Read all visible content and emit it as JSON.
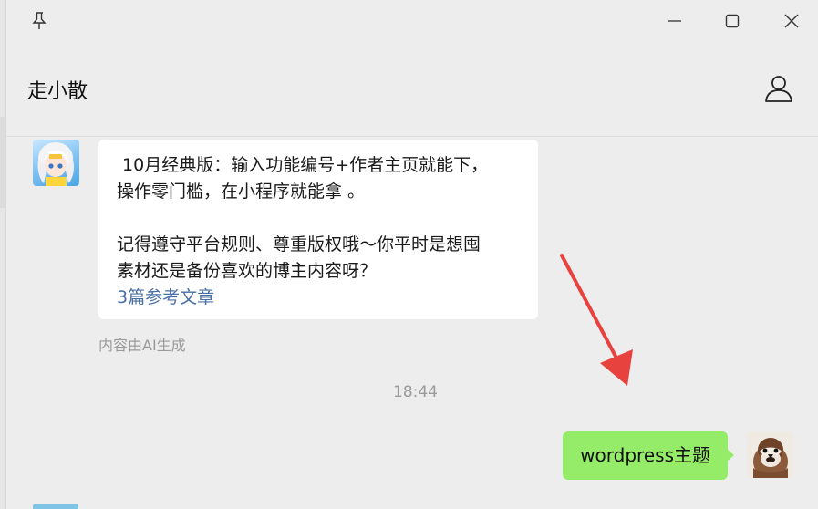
{
  "window": {
    "title": "走小散",
    "controls": [
      "pin-icon",
      "minimize-icon",
      "maximize-icon",
      "close-icon"
    ]
  },
  "header": {
    "chat_title": "走小散",
    "profile_icon": "person-icon"
  },
  "messages": [
    {
      "sender": "bot",
      "avatar_icon": "anime-avatar",
      "lines": [
        " 10月经典版：输入功能编号+作者主页就能下，",
        "操作零门槛，在小程序就能拿 。",
        "",
        "记得遵守平台规则、尊重版权哦～你平时是想囤",
        "素材还是备份喜欢的博主内容呀？"
      ],
      "reference_link": "3篇参考文章",
      "footnote": "内容由AI生成"
    },
    {
      "type": "timestamp",
      "text": "18:44"
    },
    {
      "sender": "me",
      "avatar_icon": "sparrow-avatar",
      "text": "wordpress主题"
    }
  ],
  "colors": {
    "background": "#ededed",
    "incoming_bubble": "#ffffff",
    "outgoing_bubble": "#95ec69",
    "link": "#4a6fa5",
    "annotation_arrow": "#e8423f"
  }
}
